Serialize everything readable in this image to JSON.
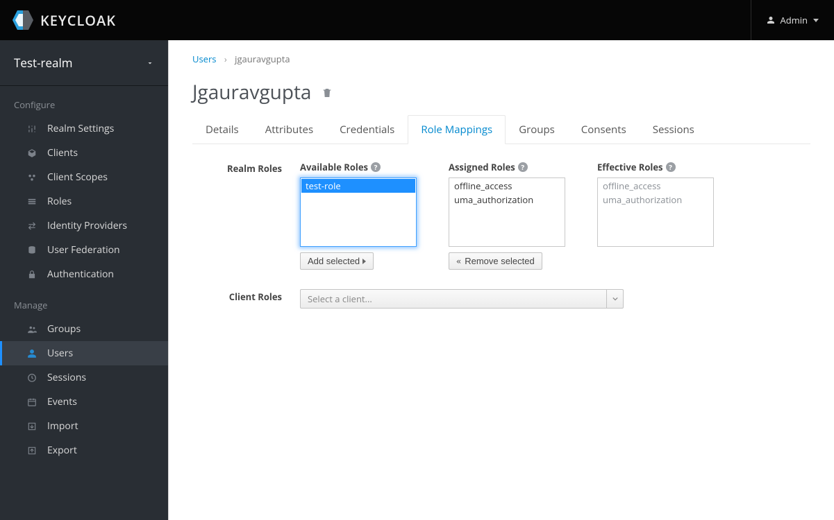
{
  "header": {
    "brand": "KEYCLOAK",
    "account_label": "Admin"
  },
  "sidebar": {
    "realm": "Test-realm",
    "section_configure": "Configure",
    "section_manage": "Manage",
    "configure_items": [
      {
        "label": "Realm Settings"
      },
      {
        "label": "Clients"
      },
      {
        "label": "Client Scopes"
      },
      {
        "label": "Roles"
      },
      {
        "label": "Identity Providers"
      },
      {
        "label": "User Federation"
      },
      {
        "label": "Authentication"
      }
    ],
    "manage_items": [
      {
        "label": "Groups"
      },
      {
        "label": "Users"
      },
      {
        "label": "Sessions"
      },
      {
        "label": "Events"
      },
      {
        "label": "Import"
      },
      {
        "label": "Export"
      }
    ]
  },
  "breadcrumb": {
    "root": "Users",
    "current": "jgauravgupta"
  },
  "page": {
    "title": "Jgauravgupta"
  },
  "tabs": [
    {
      "label": "Details"
    },
    {
      "label": "Attributes"
    },
    {
      "label": "Credentials"
    },
    {
      "label": "Role Mappings"
    },
    {
      "label": "Groups"
    },
    {
      "label": "Consents"
    },
    {
      "label": "Sessions"
    }
  ],
  "roleMapping": {
    "realm_roles_label": "Realm Roles",
    "client_roles_label": "Client Roles",
    "available_label": "Available Roles",
    "assigned_label": "Assigned Roles",
    "effective_label": "Effective Roles",
    "add_selected_btn": "Add selected",
    "remove_selected_btn": "Remove selected",
    "available_roles": [
      "test-role"
    ],
    "assigned_roles": [
      "offline_access",
      "uma_authorization"
    ],
    "effective_roles": [
      "offline_access",
      "uma_authorization"
    ],
    "client_select_placeholder": "Select a client..."
  }
}
